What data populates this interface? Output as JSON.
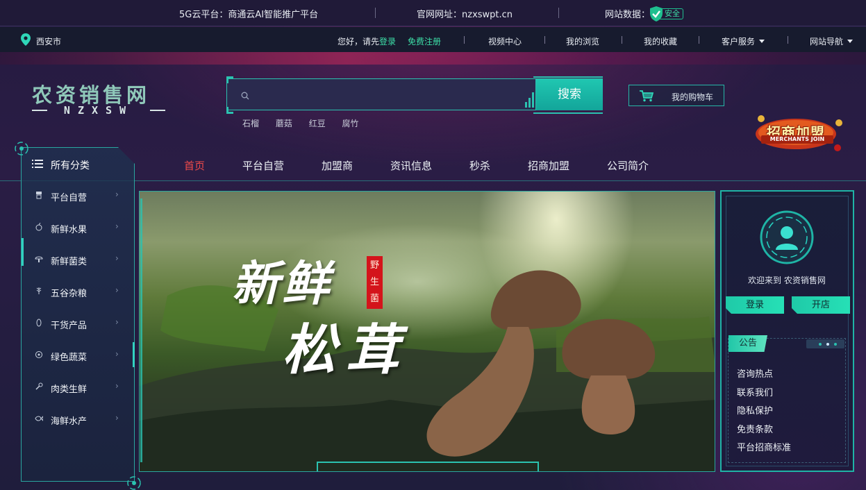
{
  "topbar": {
    "platform": "5G云平台：商通云AI智能推广平台",
    "site_url": "官网网址：nzxswpt.cn",
    "site_data_label": "网站数据：",
    "safe_label": "安全"
  },
  "subnav": {
    "city": "西安市",
    "greeting": "您好，请先",
    "login": "登录",
    "register": "免费注册",
    "links": [
      "视频中心",
      "我的浏览",
      "我的收藏",
      "客户服务",
      "网站导航"
    ]
  },
  "logo": {
    "title": "农资销售网",
    "subtitle": "NZXSW"
  },
  "search": {
    "placeholder": "",
    "button": "搜索",
    "hot_words": [
      "石榴",
      "蘑菇",
      "红豆",
      "腐竹"
    ]
  },
  "cart": {
    "label": "我的购物车"
  },
  "join_badge": {
    "title": "招商加盟",
    "subtitle": "MERCHANTS JOIN"
  },
  "mainnav": {
    "items": [
      "首页",
      "平台自营",
      "加盟商",
      "资讯信息",
      "秒杀",
      "招商加盟",
      "公司简介"
    ],
    "active_index": 0
  },
  "categories": {
    "header": "所有分类",
    "items": [
      "平台自营",
      "新鲜水果",
      "新鲜菌类",
      "五谷杂粮",
      "干货产品",
      "绿色蔬菜",
      "肉类生鲜",
      "海鲜水产"
    ],
    "arrow": "›"
  },
  "banner": {
    "line1": "新鲜",
    "line2": "松茸",
    "seal": "野生菌"
  },
  "user_panel": {
    "welcome": "欢迎来到 农资销售网",
    "login": "登录",
    "open_shop": "开店",
    "notice_tab": "公告",
    "notices": [
      "咨询热点",
      "联系我们",
      "隐私保护",
      "免责条款",
      "平台招商标准"
    ]
  },
  "colors": {
    "accent": "#2bc2b0",
    "active_nav": "#f04a4a",
    "highlight_green": "#3de0a8",
    "seal_red": "#d4141b"
  }
}
